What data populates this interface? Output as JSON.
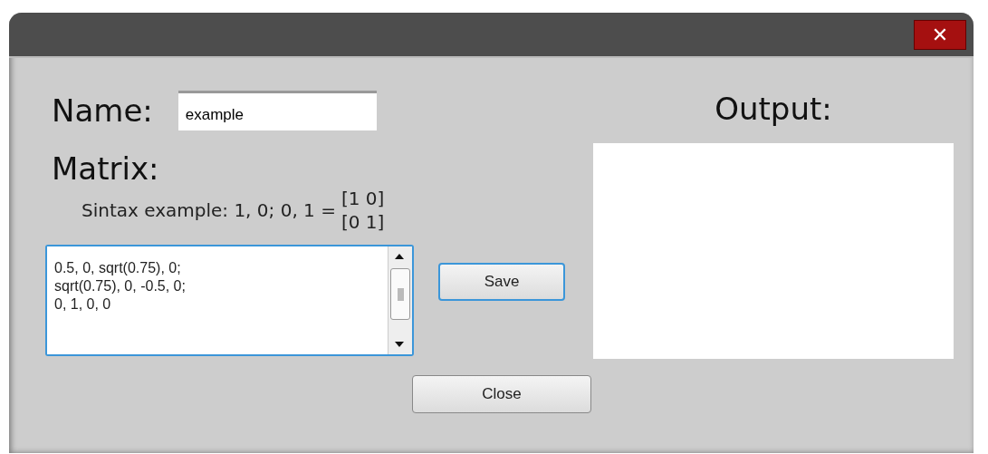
{
  "window": {
    "close_button": "✕"
  },
  "name": {
    "label": "Name:",
    "value": "example"
  },
  "matrix": {
    "label": "Matrix:",
    "syntax": "Sintax example: 1, 0; 0, 1 =",
    "syntax_rows": [
      "[1 0]",
      "[0 1]"
    ],
    "lines": [
      "0.5, 0, sqrt(0.75), 0;",
      "sqrt(0.75), 0, -0.5, 0;",
      "0, 1, 0, 0"
    ]
  },
  "save_button": "Save",
  "output": {
    "label": "Output:"
  },
  "close_button": "Close"
}
